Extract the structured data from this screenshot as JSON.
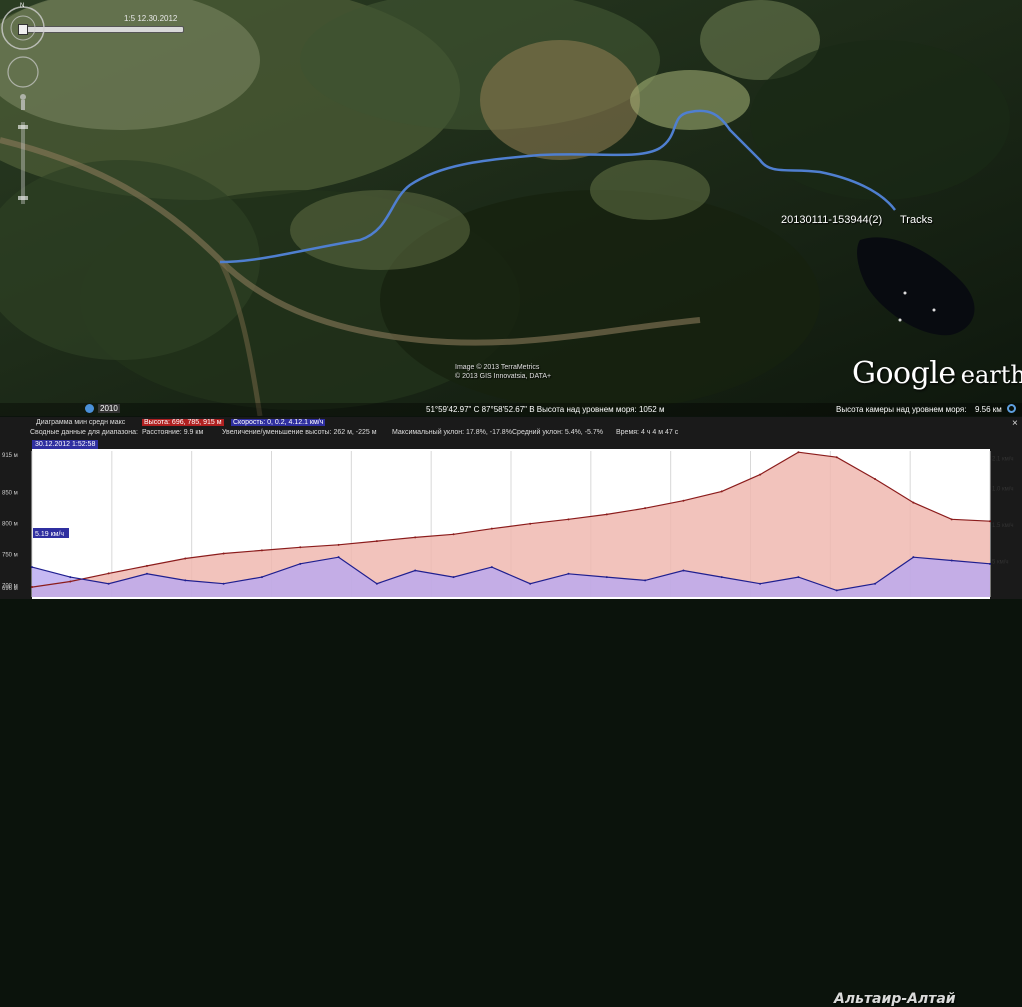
{
  "colors": {
    "track": "#4f7fd0",
    "elevation_line": "#8b1c1c",
    "elevation_fill": "#f0b8b0",
    "speed_line": "#1f1f8f",
    "speed_fill": "#b8a8f0",
    "highlight_height": "#b02020",
    "highlight_speed": "#2f2fa0"
  },
  "map": {
    "time_label": "1:5 12.30.2012",
    "track_label": "20130111-153944(2)",
    "track_name2": "Tracks",
    "attribution_1": "Image © 2013 TerraMetrics",
    "attribution_2": "© 2013 GIS Innovatsia, DATA+",
    "logo_google": "Google",
    "logo_earth": "earth",
    "year": "2010",
    "coords": "51°59'42.97\" С   87°58'52.67\" В  Высота над уровнем моря:  1052 м",
    "eye_label": "Высота камеры над уровнем моря:",
    "eye_value": "9.56 км",
    "icons": [
      "compass-icon",
      "look-joystick-icon",
      "zoom-slider-icon",
      "pegman-icon"
    ]
  },
  "panel": {
    "diagram_label": "Диаграмма  мин   средн   макс",
    "height_sel": "Высота: 696, 785, 915 м",
    "speed_sel": "Скорость: 0, 0.2, 4.12.1 км/ч",
    "summary_label": "Сводные данные для диапазона:",
    "distance": "Расстояние: 9.9 км",
    "elev_gain": "Увеличение/уменьшение высоты: 262 м, -225 м",
    "max_slope": "Максимальный уклон: 17.8%, -17.8%",
    "avg_slope": "Средний уклон: 5.4%, -5.7%",
    "time": "Время: 4 ч 4 м 47 с",
    "date": "30.12.2012 1:52:58",
    "close": "×",
    "watermark": "Альтаир-Алтай"
  },
  "chart_data": {
    "type": "area",
    "title": "",
    "xlabel": "",
    "ylabel": "",
    "left_axis": {
      "ticks": [
        "915 м",
        "850 м",
        "800 м",
        "750 м",
        "700 м",
        "696 м"
      ],
      "ylim": [
        680,
        915
      ]
    },
    "right_axis": {
      "ticks": [
        "2.1 км/ч",
        "1.0 км/ч",
        "1.5 км/ч",
        "5 км/ч"
      ],
      "ylim": [
        0,
        2.2
      ]
    },
    "speed_marker": "5.19 км/ч",
    "x": [
      0,
      4,
      8,
      12,
      16,
      20,
      24,
      28,
      32,
      36,
      40,
      44,
      48,
      52,
      56,
      60,
      64,
      68,
      72,
      76,
      80,
      84,
      88,
      92,
      96,
      100
    ],
    "series": [
      {
        "name": "Высота",
        "values": [
          696,
          705,
          718,
          730,
          742,
          750,
          755,
          760,
          764,
          770,
          776,
          781,
          790,
          798,
          805,
          813,
          823,
          835,
          850,
          877,
          913,
          905,
          870,
          832,
          805,
          802
        ]
      },
      {
        "name": "Скорость",
        "values": [
          0.45,
          0.3,
          0.2,
          0.35,
          0.25,
          0.2,
          0.3,
          0.5,
          0.6,
          0.2,
          0.4,
          0.3,
          0.45,
          0.2,
          0.35,
          0.3,
          0.25,
          0.4,
          0.3,
          0.2,
          0.3,
          0.1,
          0.2,
          0.6,
          0.55,
          0.5
        ]
      }
    ]
  }
}
